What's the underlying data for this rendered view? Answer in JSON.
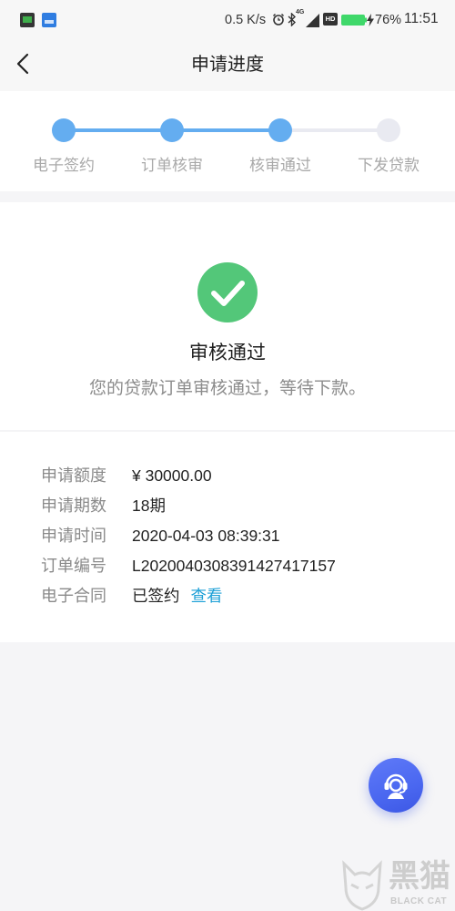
{
  "status_bar": {
    "network_speed": "0.5 K/s",
    "network_type": "4G",
    "hd_label": "HD",
    "battery": "76%",
    "time": "11:51",
    "icons": [
      "app-notification-icon",
      "app-notification-icon",
      "alarm-icon",
      "bluetooth-icon",
      "signal-icon",
      "hd-icon",
      "battery-icon",
      "charging-icon"
    ]
  },
  "header": {
    "back_icon": "chevron-left-icon",
    "title": "申请进度"
  },
  "progress": {
    "steps": [
      {
        "label": "电子签约",
        "done": true
      },
      {
        "label": "订单核审",
        "done": true
      },
      {
        "label": "核审通过",
        "done": true
      },
      {
        "label": "下发贷款",
        "done": false
      }
    ]
  },
  "result": {
    "icon": "check-circle-icon",
    "title": "审核通过",
    "message": "您的贷款订单审核通过，等待下款。"
  },
  "details": {
    "rows": [
      {
        "label": "申请额度",
        "value": "¥ 30000.00"
      },
      {
        "label": "申请期数",
        "value": "18期"
      },
      {
        "label": "申请时间",
        "value": "2020-04-03 08:39:31"
      },
      {
        "label": "订单编号",
        "value": "L2020040308391427417157"
      },
      {
        "label": "电子合同",
        "value": "已签约",
        "link": "查看"
      }
    ]
  },
  "customer_service": {
    "icon": "headset-icon"
  },
  "watermark": {
    "title": "黑猫",
    "subtitle": "BLACK CAT"
  },
  "colors": {
    "accent": "#64adf0",
    "inactive": "#e9eaf1",
    "success": "#53c779",
    "link": "#1c9fd6",
    "fab": "#4a67f0"
  }
}
